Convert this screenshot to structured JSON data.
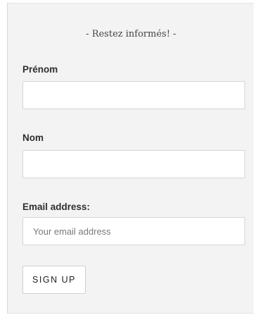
{
  "form": {
    "title": "- Restez informés! -",
    "fields": [
      {
        "label": "Prénom",
        "value": "",
        "placeholder": ""
      },
      {
        "label": "Nom",
        "value": "",
        "placeholder": ""
      },
      {
        "label": "Email address:",
        "value": "",
        "placeholder": "Your email address"
      }
    ],
    "submit_label": "SIGN UP"
  }
}
